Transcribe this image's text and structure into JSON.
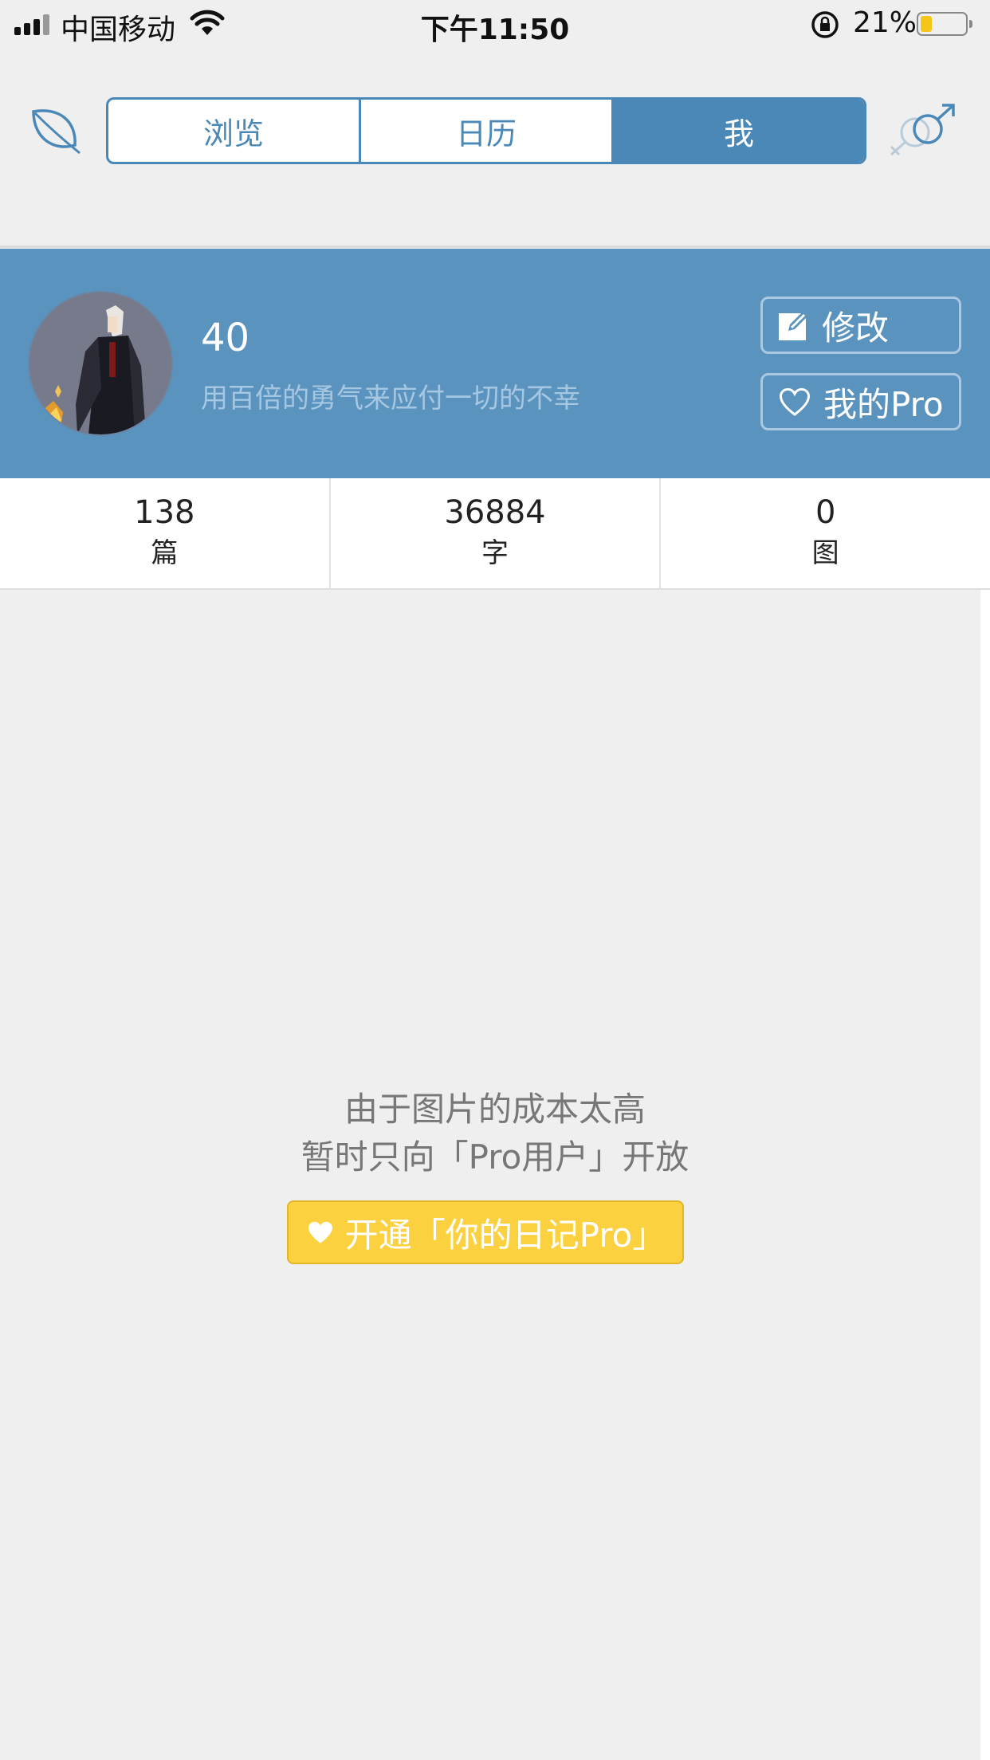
{
  "status_bar": {
    "carrier": "中国移动",
    "time": "下午11:50",
    "battery_percent": "21%",
    "battery_level": 0.21,
    "battery_color": "#f5c518"
  },
  "nav": {
    "tabs": [
      "浏览",
      "日历",
      "我"
    ],
    "active_tab": "我",
    "left_icon": "leaf-icon",
    "right_icon": "gender-symbol-icon",
    "accent_color": "#4a88b7"
  },
  "profile": {
    "username": "40",
    "motto": "用百倍的勇气来应付一切的不幸",
    "edit_label": "修改",
    "pro_label": "我的Pro",
    "background_color": "#5b93bf"
  },
  "stats": [
    {
      "value": "138",
      "label": "篇"
    },
    {
      "value": "36884",
      "label": "字"
    },
    {
      "value": "0",
      "label": "图"
    }
  ],
  "empty_state": {
    "line1": "由于图片的成本太高",
    "line2": "暂时只向「Pro用户」开放",
    "cta_label": "开通「你的日记Pro」",
    "cta_color": "#fcd13f"
  }
}
